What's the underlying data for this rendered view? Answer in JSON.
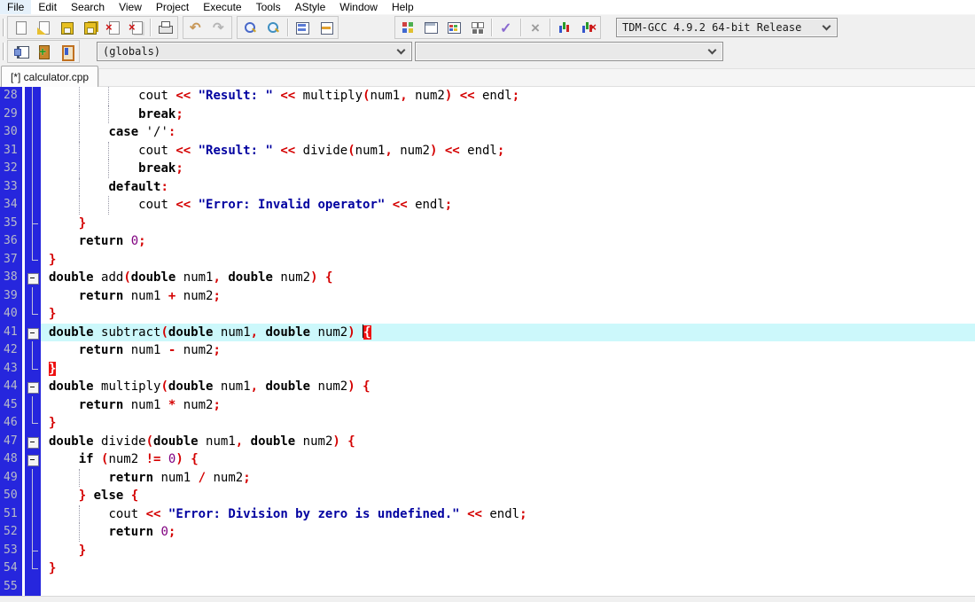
{
  "menu": {
    "items": [
      "File",
      "Edit",
      "Search",
      "View",
      "Project",
      "Execute",
      "Tools",
      "AStyle",
      "Window",
      "Help"
    ]
  },
  "toolbar_main": {
    "groups": [
      [
        "new-file",
        "open-file",
        "save",
        "save-all",
        "close-file",
        "close-all",
        "sep",
        "print"
      ],
      [
        "undo",
        "redo"
      ],
      [
        "find",
        "replace",
        "sep",
        "project-manager",
        "compile-log"
      ]
    ],
    "right_groups": [
      [
        "compile",
        "run",
        "compile-run",
        "rebuild-all",
        "sep",
        "syntax-check",
        "sep",
        "abort",
        "sep",
        "profile",
        "delete-profiling"
      ]
    ],
    "compiler_combo": "TDM-GCC 4.9.2 64-bit Release"
  },
  "toolbar_nav": {
    "icons": [
      "goto-declaration",
      "new-class",
      "view-members"
    ],
    "globals_combo": "(globals)",
    "member_combo": ""
  },
  "tabbar": {
    "active_tab": "[*] calculator.cpp"
  },
  "colors": {
    "gutter_bg": "#2626dd",
    "line_number": "#b9bcc8",
    "active_line_bg": "#ccf8fb",
    "keyword": "#000000",
    "string": "#0000a0",
    "symbol": "#d40000",
    "number": "#800080",
    "brace_match_bg": "#ee1010",
    "toolbar_bg": "#f0f0f0"
  },
  "editor": {
    "lines": [
      {
        "n": 28,
        "fold": "v",
        "tokens": [
          [
            "ws",
            "            "
          ],
          [
            "id",
            "cout"
          ],
          [
            "ws",
            " "
          ],
          [
            "sym",
            "<<"
          ],
          [
            "ws",
            " "
          ],
          [
            "str",
            "\"Result: \""
          ],
          [
            "ws",
            " "
          ],
          [
            "sym",
            "<<"
          ],
          [
            "ws",
            " "
          ],
          [
            "id",
            "multiply"
          ],
          [
            "sym",
            "("
          ],
          [
            "id",
            "num1"
          ],
          [
            "sym",
            ","
          ],
          [
            "ws",
            " "
          ],
          [
            "id",
            "num2"
          ],
          [
            "sym",
            ")"
          ],
          [
            "ws",
            " "
          ],
          [
            "sym",
            "<<"
          ],
          [
            "ws",
            " "
          ],
          [
            "id",
            "endl"
          ],
          [
            "sym",
            ";"
          ]
        ]
      },
      {
        "n": 29,
        "fold": "v",
        "tokens": [
          [
            "ws",
            "            "
          ],
          [
            "kw",
            "break"
          ],
          [
            "sym",
            ";"
          ]
        ]
      },
      {
        "n": 30,
        "fold": "v",
        "tokens": [
          [
            "ws",
            "        "
          ],
          [
            "kw",
            "case"
          ],
          [
            "ws",
            " "
          ],
          [
            "chr",
            "'/'"
          ],
          [
            "sym",
            ":"
          ]
        ]
      },
      {
        "n": 31,
        "fold": "v",
        "tokens": [
          [
            "ws",
            "            "
          ],
          [
            "id",
            "cout"
          ],
          [
            "ws",
            " "
          ],
          [
            "sym",
            "<<"
          ],
          [
            "ws",
            " "
          ],
          [
            "str",
            "\"Result: \""
          ],
          [
            "ws",
            " "
          ],
          [
            "sym",
            "<<"
          ],
          [
            "ws",
            " "
          ],
          [
            "id",
            "divide"
          ],
          [
            "sym",
            "("
          ],
          [
            "id",
            "num1"
          ],
          [
            "sym",
            ","
          ],
          [
            "ws",
            " "
          ],
          [
            "id",
            "num2"
          ],
          [
            "sym",
            ")"
          ],
          [
            "ws",
            " "
          ],
          [
            "sym",
            "<<"
          ],
          [
            "ws",
            " "
          ],
          [
            "id",
            "endl"
          ],
          [
            "sym",
            ";"
          ]
        ]
      },
      {
        "n": 32,
        "fold": "v",
        "tokens": [
          [
            "ws",
            "            "
          ],
          [
            "kw",
            "break"
          ],
          [
            "sym",
            ";"
          ]
        ]
      },
      {
        "n": 33,
        "fold": "v",
        "tokens": [
          [
            "ws",
            "        "
          ],
          [
            "kw",
            "default"
          ],
          [
            "sym",
            ":"
          ]
        ]
      },
      {
        "n": 34,
        "fold": "v",
        "tokens": [
          [
            "ws",
            "            "
          ],
          [
            "id",
            "cout"
          ],
          [
            "ws",
            " "
          ],
          [
            "sym",
            "<<"
          ],
          [
            "ws",
            " "
          ],
          [
            "str",
            "\"Error: Invalid operator\""
          ],
          [
            "ws",
            " "
          ],
          [
            "sym",
            "<<"
          ],
          [
            "ws",
            " "
          ],
          [
            "id",
            "endl"
          ],
          [
            "sym",
            ";"
          ]
        ]
      },
      {
        "n": 35,
        "fold": "t",
        "tokens": [
          [
            "ws",
            "    "
          ],
          [
            "sym",
            "}"
          ]
        ]
      },
      {
        "n": 36,
        "fold": "v",
        "tokens": [
          [
            "ws",
            "    "
          ],
          [
            "kw",
            "return"
          ],
          [
            "ws",
            " "
          ],
          [
            "num",
            "0"
          ],
          [
            "sym",
            ";"
          ]
        ]
      },
      {
        "n": 37,
        "fold": "e",
        "tokens": [
          [
            "sym",
            "}"
          ]
        ]
      },
      {
        "n": 38,
        "fold": "b",
        "tokens": [
          [
            "kw",
            "double"
          ],
          [
            "ws",
            " "
          ],
          [
            "id",
            "add"
          ],
          [
            "sym",
            "("
          ],
          [
            "kw",
            "double"
          ],
          [
            "ws",
            " "
          ],
          [
            "id",
            "num1"
          ],
          [
            "sym",
            ","
          ],
          [
            "ws",
            " "
          ],
          [
            "kw",
            "double"
          ],
          [
            "ws",
            " "
          ],
          [
            "id",
            "num2"
          ],
          [
            "sym",
            ")"
          ],
          [
            "ws",
            " "
          ],
          [
            "sym",
            "{"
          ]
        ]
      },
      {
        "n": 39,
        "fold": "v",
        "tokens": [
          [
            "ws",
            "    "
          ],
          [
            "kw",
            "return"
          ],
          [
            "ws",
            " "
          ],
          [
            "id",
            "num1"
          ],
          [
            "ws",
            " "
          ],
          [
            "sym",
            "+"
          ],
          [
            "ws",
            " "
          ],
          [
            "id",
            "num2"
          ],
          [
            "sym",
            ";"
          ]
        ]
      },
      {
        "n": 40,
        "fold": "e",
        "tokens": [
          [
            "sym",
            "}"
          ]
        ]
      },
      {
        "n": 41,
        "fold": "b",
        "active": true,
        "tokens": [
          [
            "kw",
            "double"
          ],
          [
            "ws",
            " "
          ],
          [
            "id",
            "subtract"
          ],
          [
            "sym",
            "("
          ],
          [
            "kw",
            "double"
          ],
          [
            "ws",
            " "
          ],
          [
            "id",
            "num1"
          ],
          [
            "sym",
            ","
          ],
          [
            "ws",
            " "
          ],
          [
            "kw",
            "double"
          ],
          [
            "ws",
            " "
          ],
          [
            "id",
            "num2"
          ],
          [
            "sym",
            ")"
          ],
          [
            "ws",
            " "
          ],
          [
            "caret",
            ""
          ],
          [
            "symhl",
            "{"
          ]
        ]
      },
      {
        "n": 42,
        "fold": "v",
        "tokens": [
          [
            "ws",
            "    "
          ],
          [
            "kw",
            "return"
          ],
          [
            "ws",
            " "
          ],
          [
            "id",
            "num1"
          ],
          [
            "ws",
            " "
          ],
          [
            "sym",
            "-"
          ],
          [
            "ws",
            " "
          ],
          [
            "id",
            "num2"
          ],
          [
            "sym",
            ";"
          ]
        ]
      },
      {
        "n": 43,
        "fold": "e",
        "tokens": [
          [
            "symhl",
            "}"
          ]
        ]
      },
      {
        "n": 44,
        "fold": "b",
        "tokens": [
          [
            "kw",
            "double"
          ],
          [
            "ws",
            " "
          ],
          [
            "id",
            "multiply"
          ],
          [
            "sym",
            "("
          ],
          [
            "kw",
            "double"
          ],
          [
            "ws",
            " "
          ],
          [
            "id",
            "num1"
          ],
          [
            "sym",
            ","
          ],
          [
            "ws",
            " "
          ],
          [
            "kw",
            "double"
          ],
          [
            "ws",
            " "
          ],
          [
            "id",
            "num2"
          ],
          [
            "sym",
            ")"
          ],
          [
            "ws",
            " "
          ],
          [
            "sym",
            "{"
          ]
        ]
      },
      {
        "n": 45,
        "fold": "v",
        "tokens": [
          [
            "ws",
            "    "
          ],
          [
            "kw",
            "return"
          ],
          [
            "ws",
            " "
          ],
          [
            "id",
            "num1"
          ],
          [
            "ws",
            " "
          ],
          [
            "sym",
            "*"
          ],
          [
            "ws",
            " "
          ],
          [
            "id",
            "num2"
          ],
          [
            "sym",
            ";"
          ]
        ]
      },
      {
        "n": 46,
        "fold": "e",
        "tokens": [
          [
            "sym",
            "}"
          ]
        ]
      },
      {
        "n": 47,
        "fold": "b",
        "tokens": [
          [
            "kw",
            "double"
          ],
          [
            "ws",
            " "
          ],
          [
            "id",
            "divide"
          ],
          [
            "sym",
            "("
          ],
          [
            "kw",
            "double"
          ],
          [
            "ws",
            " "
          ],
          [
            "id",
            "num1"
          ],
          [
            "sym",
            ","
          ],
          [
            "ws",
            " "
          ],
          [
            "kw",
            "double"
          ],
          [
            "ws",
            " "
          ],
          [
            "id",
            "num2"
          ],
          [
            "sym",
            ")"
          ],
          [
            "ws",
            " "
          ],
          [
            "sym",
            "{"
          ]
        ]
      },
      {
        "n": 48,
        "fold": "b",
        "tokens": [
          [
            "ws",
            "    "
          ],
          [
            "kw",
            "if"
          ],
          [
            "ws",
            " "
          ],
          [
            "sym",
            "("
          ],
          [
            "id",
            "num2"
          ],
          [
            "ws",
            " "
          ],
          [
            "sym",
            "!="
          ],
          [
            "ws",
            " "
          ],
          [
            "num",
            "0"
          ],
          [
            "sym",
            ")"
          ],
          [
            "ws",
            " "
          ],
          [
            "sym",
            "{"
          ]
        ]
      },
      {
        "n": 49,
        "fold": "v",
        "tokens": [
          [
            "ws",
            "        "
          ],
          [
            "kw",
            "return"
          ],
          [
            "ws",
            " "
          ],
          [
            "id",
            "num1"
          ],
          [
            "ws",
            " "
          ],
          [
            "sym",
            "/"
          ],
          [
            "ws",
            " "
          ],
          [
            "id",
            "num2"
          ],
          [
            "sym",
            ";"
          ]
        ]
      },
      {
        "n": 50,
        "fold": "v",
        "tokens": [
          [
            "ws",
            "    "
          ],
          [
            "sym",
            "}"
          ],
          [
            "ws",
            " "
          ],
          [
            "kw",
            "else"
          ],
          [
            "ws",
            " "
          ],
          [
            "sym",
            "{"
          ]
        ]
      },
      {
        "n": 51,
        "fold": "v",
        "tokens": [
          [
            "ws",
            "        "
          ],
          [
            "id",
            "cout"
          ],
          [
            "ws",
            " "
          ],
          [
            "sym",
            "<<"
          ],
          [
            "ws",
            " "
          ],
          [
            "str",
            "\"Error: Division by zero is undefined.\""
          ],
          [
            "ws",
            " "
          ],
          [
            "sym",
            "<<"
          ],
          [
            "ws",
            " "
          ],
          [
            "id",
            "endl"
          ],
          [
            "sym",
            ";"
          ]
        ]
      },
      {
        "n": 52,
        "fold": "v",
        "tokens": [
          [
            "ws",
            "        "
          ],
          [
            "kw",
            "return"
          ],
          [
            "ws",
            " "
          ],
          [
            "num",
            "0"
          ],
          [
            "sym",
            ";"
          ]
        ]
      },
      {
        "n": 53,
        "fold": "t",
        "tokens": [
          [
            "ws",
            "    "
          ],
          [
            "sym",
            "}"
          ]
        ]
      },
      {
        "n": 54,
        "fold": "e",
        "tokens": [
          [
            "sym",
            "}"
          ]
        ]
      },
      {
        "n": 55,
        "fold": "",
        "tokens": []
      }
    ]
  }
}
